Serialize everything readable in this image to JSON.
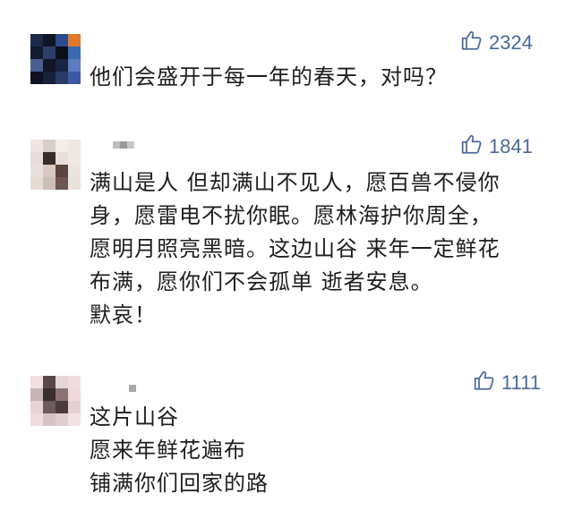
{
  "comments": [
    {
      "likes": "2324",
      "lines": [
        "他们会盛开于每一年的春天，对吗？"
      ]
    },
    {
      "likes": "1841",
      "lines": [
        "满山是人 但却满山不见人，愿百兽不侵你",
        "身，愿雷电不扰你眠。愿林海护你周全，",
        "愿明月照亮黑暗。这边山谷 来年一定鲜花",
        "布满，愿你们不会孤单 逝者安息。",
        "默哀！"
      ]
    },
    {
      "likes": "1111",
      "lines": [
        "这片山谷",
        "愿来年鲜花遍布",
        "铺满你们回家的路"
      ]
    }
  ],
  "icons": {
    "like": "thumbs-up-icon"
  },
  "colors": {
    "like": "#4a6a9a",
    "text": "#1e1e1e",
    "background": "#ffffff"
  }
}
